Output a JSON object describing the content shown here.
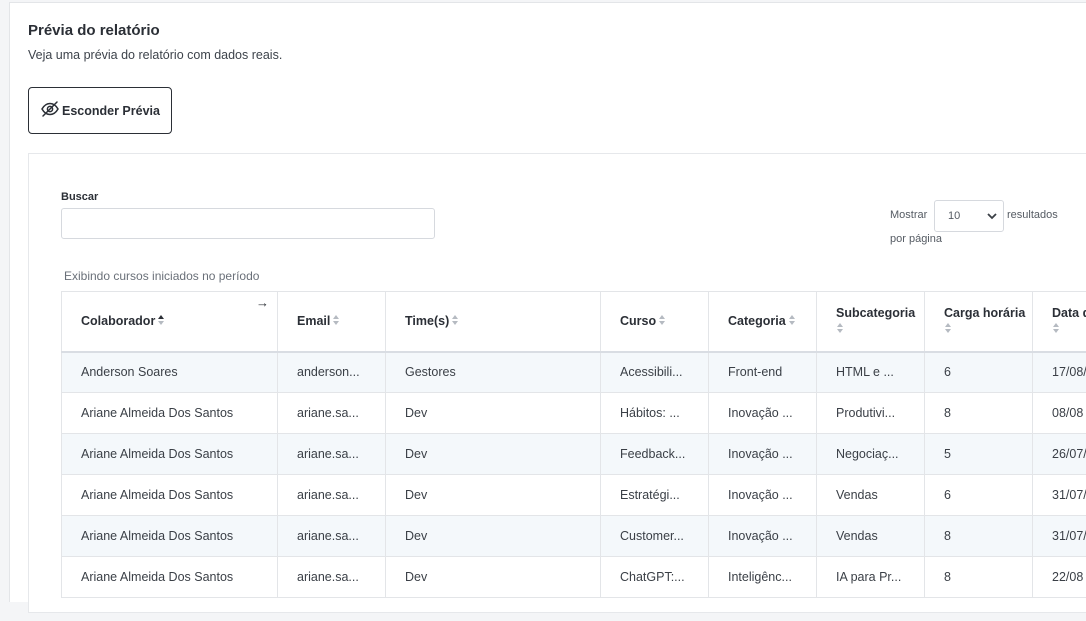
{
  "header": {
    "title": "Prévia do relatório",
    "subtitle": "Veja uma prévia do relatório com dados reais."
  },
  "toggle_button": {
    "label": "Esconder Prévia",
    "icon": "eye-off-icon"
  },
  "filters": {
    "search_label": "Buscar",
    "search_value": "",
    "show_label": "Mostrar",
    "per_page_value": "10",
    "results_label": "resultados",
    "per_page_label": "por página"
  },
  "note": "Exibindo cursos iniciados no período",
  "table": {
    "columns": [
      {
        "label": "Colaborador"
      },
      {
        "label": "Email"
      },
      {
        "label": "Time(s)"
      },
      {
        "label": "Curso"
      },
      {
        "label": "Categoria"
      },
      {
        "label": "Subcategoria"
      },
      {
        "label": "Carga horária"
      },
      {
        "label": "Data d"
      }
    ],
    "rows": [
      [
        "Anderson Soares",
        "anderson...",
        "Gestores",
        "Acessibili...",
        "Front-end",
        "HTML e ...",
        "6",
        "17/08/"
      ],
      [
        "Ariane Almeida Dos Santos",
        "ariane.sa...",
        "Dev",
        "Hábitos: ...",
        "Inovação ...",
        "Produtivi...",
        "8",
        "08/08"
      ],
      [
        "Ariane Almeida Dos Santos",
        "ariane.sa...",
        "Dev",
        "Feedback...",
        "Inovação ...",
        "Negociaç...",
        "5",
        "26/07/"
      ],
      [
        "Ariane Almeida Dos Santos",
        "ariane.sa...",
        "Dev",
        "Estratégi...",
        "Inovação ...",
        "Vendas",
        "6",
        "31/07/"
      ],
      [
        "Ariane Almeida Dos Santos",
        "ariane.sa...",
        "Dev",
        "Customer...",
        "Inovação ...",
        "Vendas",
        "8",
        "31/07/"
      ],
      [
        "Ariane Almeida Dos Santos",
        "ariane.sa...",
        "Dev",
        "ChatGPT:...",
        "Inteligênc...",
        "IA para Pr...",
        "8",
        "22/08"
      ]
    ]
  }
}
